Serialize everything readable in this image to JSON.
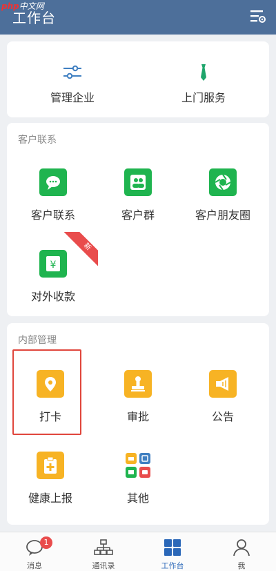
{
  "header": {
    "title": "工作台",
    "watermark_php": "php",
    "watermark_cn": "中文网"
  },
  "services": [
    {
      "label": "管理企业",
      "icon": "sliders-icon"
    },
    {
      "label": "上门服务",
      "icon": "tie-icon"
    }
  ],
  "customer_section": {
    "title": "客户联系",
    "items": [
      {
        "label": "客户联系",
        "icon": "chat-bubble-icon",
        "color": "#1fb44f"
      },
      {
        "label": "客户群",
        "icon": "group-icon",
        "color": "#1fb44f"
      },
      {
        "label": "客户朋友圈",
        "icon": "aperture-icon",
        "color": "#1fb44f"
      },
      {
        "label": "对外收款",
        "icon": "yen-wallet-icon",
        "color": "#1fb44f",
        "ribbon": "新"
      }
    ]
  },
  "internal_section": {
    "title": "内部管理",
    "items": [
      {
        "label": "打卡",
        "icon": "location-pin-icon",
        "color": "#f7b324"
      },
      {
        "label": "审批",
        "icon": "stamp-icon",
        "color": "#f7b324"
      },
      {
        "label": "公告",
        "icon": "megaphone-icon",
        "color": "#f7b324"
      },
      {
        "label": "健康上报",
        "icon": "clipboard-plus-icon",
        "color": "#f7b324"
      },
      {
        "label": "其他",
        "icon": "grid-apps-icon",
        "color": "multi"
      }
    ]
  },
  "tabbar": {
    "items": [
      {
        "label": "消息",
        "icon": "message-icon",
        "badge": "1"
      },
      {
        "label": "通讯录",
        "icon": "org-chart-icon"
      },
      {
        "label": "工作台",
        "icon": "workbench-grid-icon",
        "active": true
      },
      {
        "label": "我",
        "icon": "person-icon"
      }
    ]
  },
  "colors": {
    "header_bg": "#4d6f9a",
    "accent_blue": "#2a67b8",
    "highlight_red": "#e0463c"
  }
}
